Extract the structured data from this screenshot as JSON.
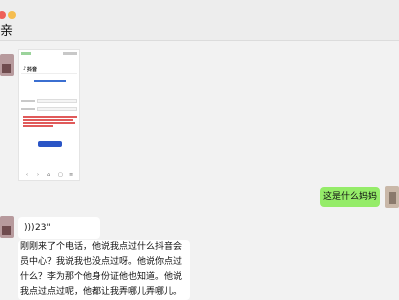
{
  "window": {
    "chat_title": "亲"
  },
  "shared_screenshot": {
    "app_name": "抖音"
  },
  "messages": {
    "outgoing_text": "这是什么妈妈",
    "voice_duration": "23\"",
    "voice_transcript": "刚刚来了个电话，他说我点过什么抖音会员中心？我说我也没点过呀。他说你点过什么？李为那个他身份证他也知道。他说我点过点过呢，他都让我弄哪儿弄哪儿。他说那个。刚到"
  },
  "colors": {
    "bubble_outgoing": "#95ec69",
    "bubble_incoming": "#ffffff",
    "accent_blue": "#2a55c6"
  }
}
